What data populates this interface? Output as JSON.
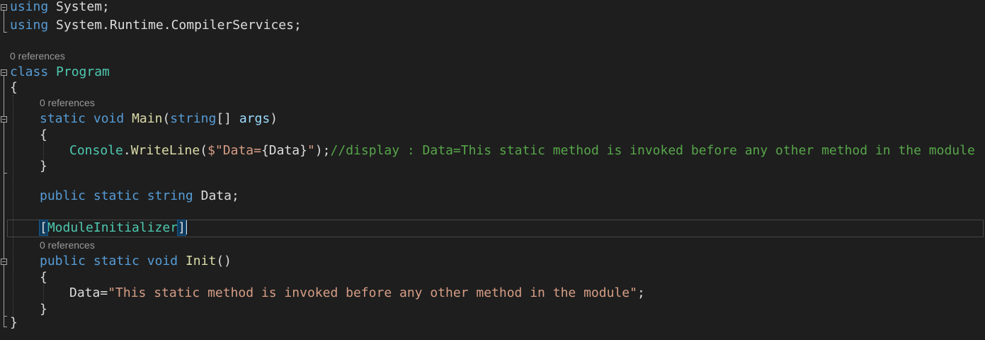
{
  "code": {
    "line1": {
      "kw": "using",
      "ns": " System;"
    },
    "line2": {
      "kw": "using",
      "ns": " System.Runtime.CompilerServices;"
    },
    "lens1": "0 references",
    "line3": {
      "kw": "class",
      "space": " ",
      "name": "Program"
    },
    "line4": "{",
    "lens2": "0 references",
    "line5": {
      "kw1": "static",
      "kw2": "void",
      "method": "Main",
      "open": "(",
      "type": "string",
      "arr": "[] ",
      "param": "args",
      "close": ")"
    },
    "line6": "{",
    "line7": {
      "cls": "Console",
      "dot": ".",
      "method": "WriteLine",
      "open": "(",
      "str1": "$\"Data=",
      "interp": "{Data}",
      "str2": "\"",
      "close": ");",
      "comment": "//display : Data=This static method is invoked before any other method in the module"
    },
    "line8": "}",
    "line9": {
      "kw1": "public",
      "kw2": "static",
      "kw3": "string",
      "name": " Data;"
    },
    "line10": {
      "open": "[",
      "attr": "ModuleInitializer",
      "close": "]"
    },
    "lens3": "0 references",
    "line11": {
      "kw1": "public",
      "kw2": "static",
      "kw3": "void",
      "method": "Init",
      "parens": "()"
    },
    "line12": "{",
    "line13": {
      "name": "Data=",
      "str": "\"This static method is invoked before any other method in the module\"",
      "end": ";"
    },
    "line14": "}",
    "line15": "}"
  },
  "colors": {
    "background": "#1e1e1e",
    "keyword": "#569cd6",
    "type": "#4ec9b0",
    "method": "#dcdcaa",
    "string": "#d69d85",
    "comment": "#57a64a"
  }
}
